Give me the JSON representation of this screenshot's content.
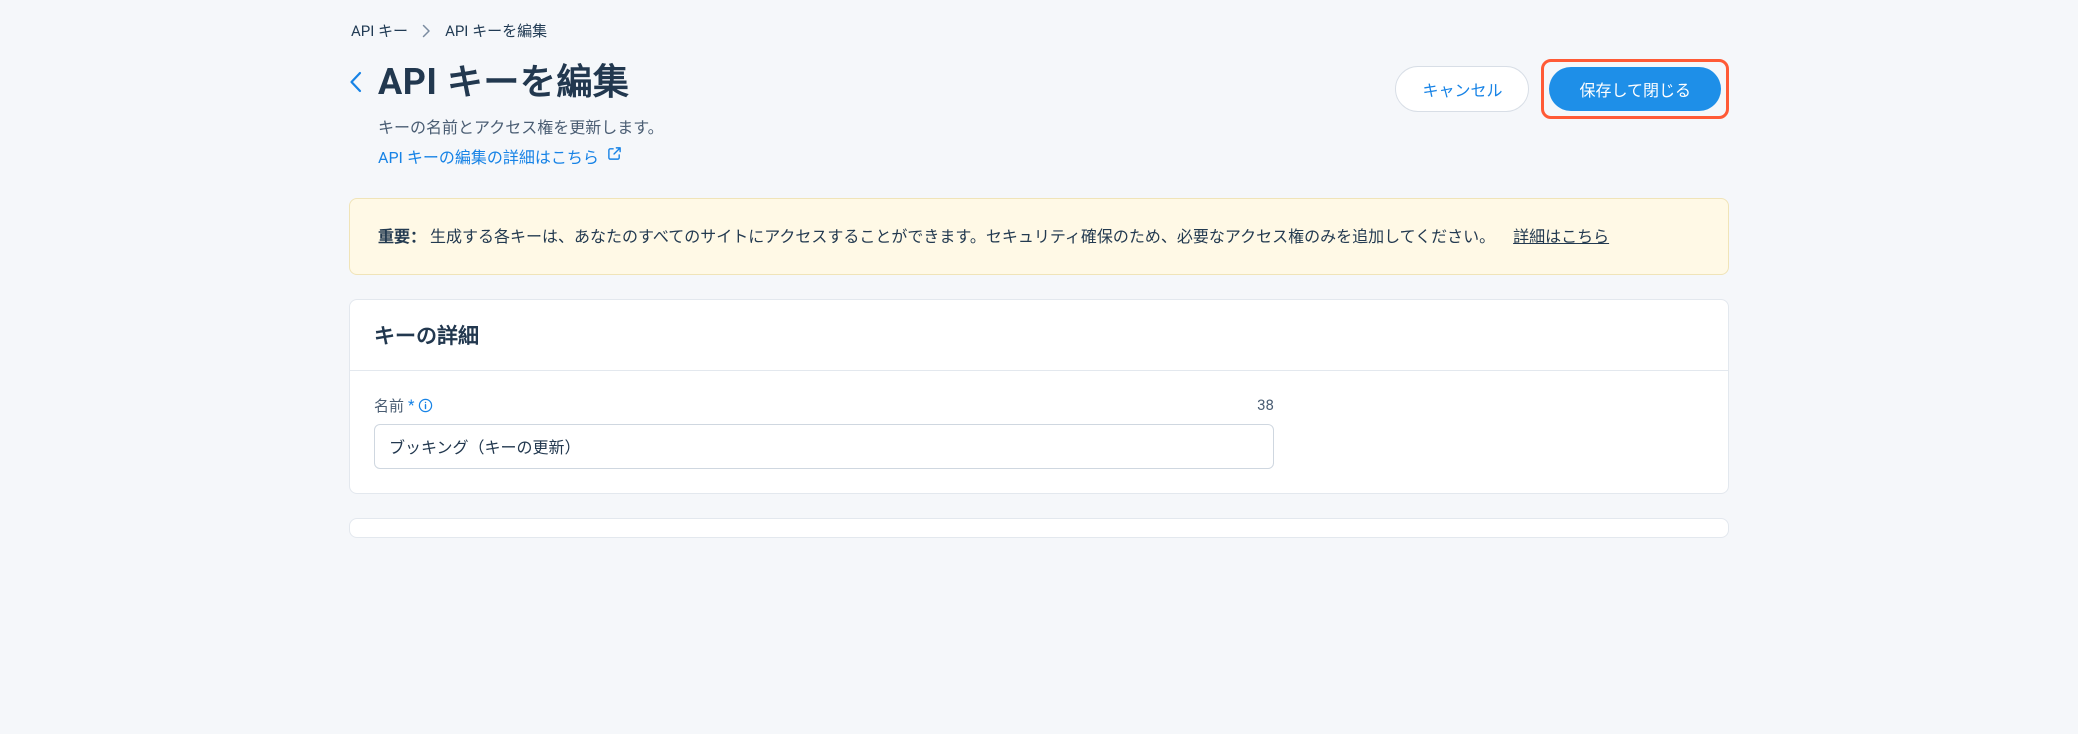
{
  "breadcrumb": {
    "items": [
      "API キー",
      "API キーを編集"
    ]
  },
  "header": {
    "title": "API キーを編集",
    "subtitle": "キーの名前とアクセス権を更新します。",
    "help_link": "API キーの編集の詳細はこちら"
  },
  "actions": {
    "cancel": "キャンセル",
    "save": "保存して閉じる"
  },
  "alert": {
    "strong": "重要：",
    "text": "生成する各キーは、あなたのすべてのサイトにアクセスすることができます。セキュリティ確保のため、必要なアクセス権のみを追加してください。",
    "link": "詳細はこちら"
  },
  "form": {
    "section_title": "キーの詳細",
    "name_label": "名前",
    "name_value": "ブッキング（キーの更新）",
    "name_counter": "38"
  }
}
